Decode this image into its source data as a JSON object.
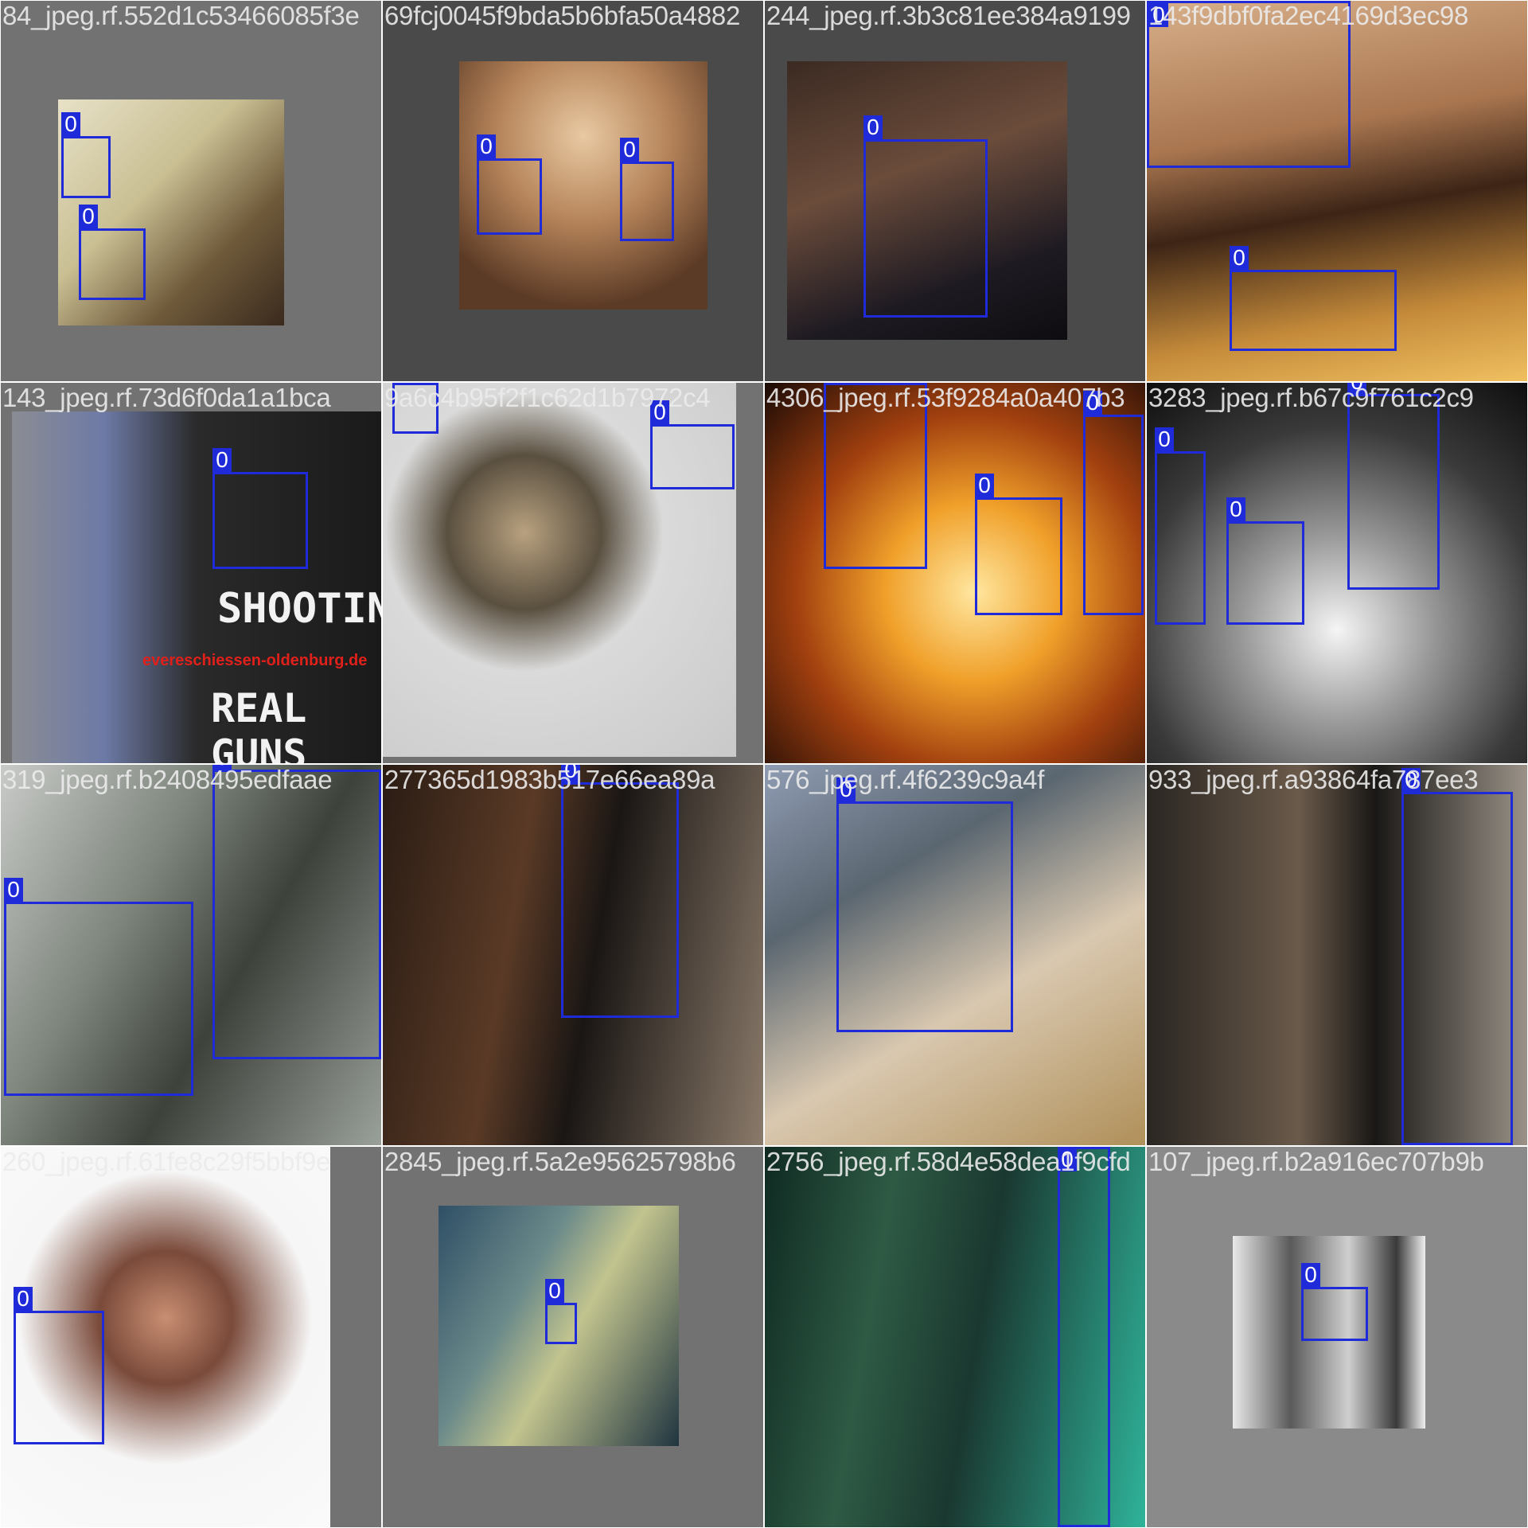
{
  "mosaic": {
    "tiles": [
      {
        "filename": "84_jpeg.rf.552d1c53466085f3e",
        "boxes": [
          {
            "label": "0"
          },
          {
            "label": "0"
          }
        ]
      },
      {
        "filename": "69fcj0045f9bda5b6bfa50a4882",
        "boxes": [
          {
            "label": "0"
          },
          {
            "label": "0"
          }
        ]
      },
      {
        "filename": "244_jpeg.rf.3b3c81ee384a9199",
        "boxes": [
          {
            "label": "0"
          }
        ]
      },
      {
        "filename": "143f9dbf0fa2ec4169d3ec98",
        "boxes": [
          {
            "label": "0"
          },
          {
            "label": "0"
          }
        ]
      },
      {
        "filename": "143_jpeg.rf.73d6f0da1a1bca",
        "boxes": [
          {
            "label": "0"
          }
        ],
        "overlay": {
          "line1": "SHOOTING",
          "line2": "REAL GUNS",
          "url": "evereschiessen-oldenburg.de"
        }
      },
      {
        "filename": "9a6c4b95f2f1c62d1b7972c4",
        "boxes": [
          {
            "label": "0"
          },
          {
            "label": "0"
          }
        ]
      },
      {
        "filename": "4306_jpeg.rf.53f9284a0a407b3",
        "boxes": [
          {
            "label": "0"
          },
          {
            "label": "0"
          },
          {
            "label": "0"
          }
        ]
      },
      {
        "filename": "3283_jpeg.rf.b67c9f761c2c9",
        "boxes": [
          {
            "label": "0"
          },
          {
            "label": "0"
          },
          {
            "label": "0"
          }
        ]
      },
      {
        "filename": "319_jpeg.rf.b2408495edfaae",
        "boxes": [
          {
            "label": "0"
          },
          {
            "label": "0"
          }
        ]
      },
      {
        "filename": "277365d1983b517e66ea89a",
        "boxes": [
          {
            "label": "0"
          }
        ]
      },
      {
        "filename": "576_jpeg.rf.4f6239c9a4f",
        "boxes": [
          {
            "label": "0"
          }
        ]
      },
      {
        "filename": "933_jpeg.rf.a93864fa787ee3",
        "boxes": [
          {
            "label": "0"
          }
        ]
      },
      {
        "filename": "260_jpeg.rf.61fe8c29f5bbf9e",
        "boxes": [
          {
            "label": "0"
          }
        ]
      },
      {
        "filename": "2845_jpeg.rf.5a2e95625798b6",
        "boxes": [
          {
            "label": "0"
          }
        ]
      },
      {
        "filename": "2756_jpeg.rf.58d4e58dea1f9cfd",
        "boxes": [
          {
            "label": "0"
          }
        ]
      },
      {
        "filename": "107_jpeg.rf.b2a916ec707b9b",
        "boxes": [
          {
            "label": "0"
          }
        ]
      }
    ]
  },
  "colors": {
    "box_border": "#1f2bd9",
    "label_bg": "#1f2bd9",
    "label_text": "#ffffff",
    "letterbox_gray": "#727272"
  }
}
